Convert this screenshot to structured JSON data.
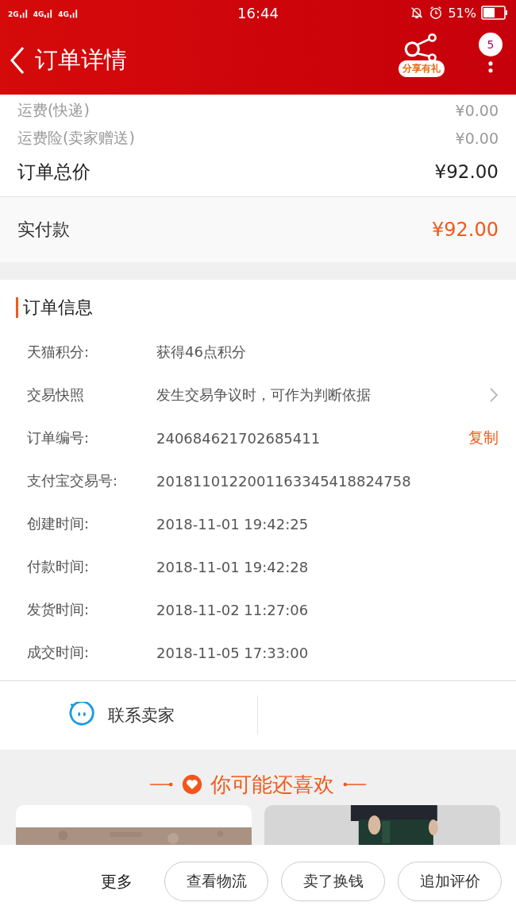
{
  "status_bar": {
    "networks": [
      "2G",
      "4G",
      "4G"
    ],
    "time": "16:44",
    "battery": "51%"
  },
  "header": {
    "title": "订单详情",
    "share_label": "分享有礼",
    "badge": "5"
  },
  "fees": [
    {
      "label": "运费(快递)",
      "amount": "¥0.00",
      "kind": "minor"
    },
    {
      "label": "运费险(卖家赠送)",
      "amount": "¥0.00",
      "kind": "minor"
    },
    {
      "label": "订单总价",
      "amount": "¥92.00",
      "kind": "total"
    }
  ],
  "paid": {
    "label": "实付款",
    "amount": "¥92.00"
  },
  "order_info": {
    "title": "订单信息",
    "rows": [
      {
        "label": "天猫积分:",
        "value": "获得46点积分",
        "kind": "plain"
      },
      {
        "label": "交易快照",
        "value": "发生交易争议时，可作为判断依据",
        "kind": "link"
      },
      {
        "label": "订单编号:",
        "value": "240684621702685411",
        "kind": "copy",
        "action": "复制"
      },
      {
        "label": "支付宝交易号:",
        "value": "2018110122001163345418824758",
        "kind": "plain"
      },
      {
        "label": "创建时间:",
        "value": "2018-11-01 19:42:25",
        "kind": "plain"
      },
      {
        "label": "付款时间:",
        "value": "2018-11-01 19:42:28",
        "kind": "plain"
      },
      {
        "label": "发货时间:",
        "value": "2018-11-02 11:27:06",
        "kind": "plain"
      },
      {
        "label": "成交时间:",
        "value": "2018-11-05 17:33:00",
        "kind": "plain"
      }
    ]
  },
  "contact": {
    "label": "联系卖家"
  },
  "recommend": {
    "title": "你可能还喜欢"
  },
  "bottom_bar": {
    "more": "更多",
    "buttons": [
      "查看物流",
      "卖了换钱",
      "追加评价"
    ]
  }
}
